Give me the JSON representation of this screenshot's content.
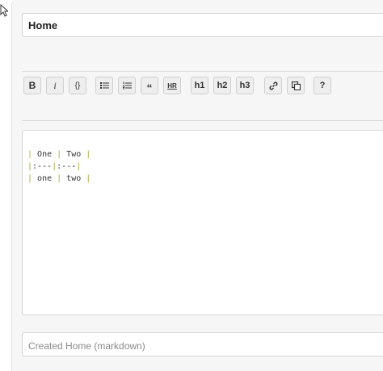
{
  "page": {
    "title_value": "Home",
    "summary_placeholder": "Created Home (markdown)"
  },
  "toolbar": {
    "bold_label": "B",
    "italic_label": "i",
    "code_label": "{}",
    "unordered_list_icon": "unordered-list-icon",
    "ordered_list_icon": "ordered-list-icon",
    "quote_label": "“",
    "hr_label": "HR",
    "h1_label": "h1",
    "h2_label": "h2",
    "h3_label": "h3",
    "link_icon": "link-icon",
    "image_icon": "image-icon",
    "help_label": "?"
  },
  "editor": {
    "lines": [
      [
        "| ",
        "One",
        " | ",
        "Two",
        " |"
      ],
      [
        "|",
        ":---",
        "|",
        ":---",
        "|"
      ],
      [
        "| ",
        "one",
        " | ",
        "two",
        " |"
      ]
    ]
  },
  "colors": {
    "pipe": "#a8a838",
    "panel": "#f6f6f6",
    "button_bg": "#eeeeee",
    "border": "#d4d4d4"
  }
}
